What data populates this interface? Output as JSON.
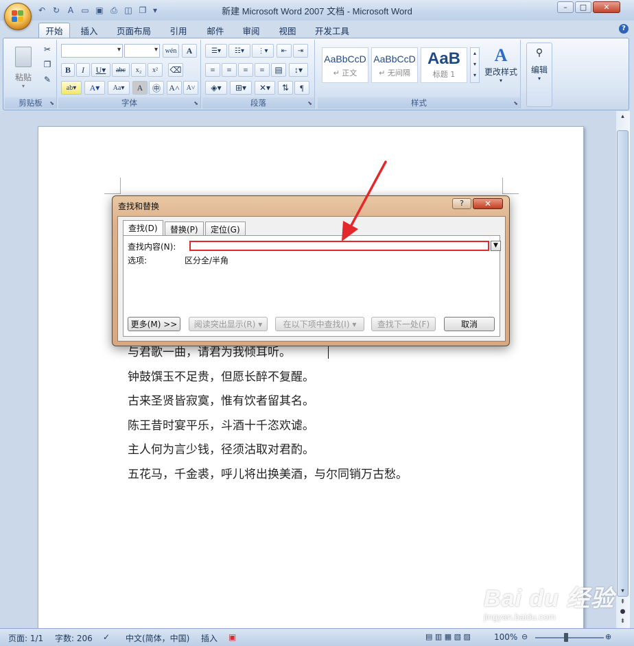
{
  "window": {
    "title": "新建 Microsoft Word 2007 文档 - Microsoft Word"
  },
  "ribbon_tabs": [
    "开始",
    "插入",
    "页面布局",
    "引用",
    "邮件",
    "审阅",
    "视图",
    "开发工具"
  ],
  "ribbon": {
    "clipboard": {
      "label": "剪贴板",
      "paste": "粘贴"
    },
    "font": {
      "label": "字体"
    },
    "paragraph": {
      "label": "段落"
    },
    "styles": {
      "label": "样式",
      "items": [
        {
          "preview": "AaBbCcD",
          "name": "↵ 正文"
        },
        {
          "preview": "AaBbCcD",
          "name": "↵ 无间隔"
        },
        {
          "preview": "AaB",
          "name": "标题 1"
        }
      ],
      "change": "更改样式"
    },
    "editing": {
      "label": "编辑"
    }
  },
  "document": {
    "lines": [
      "与君歌一曲，请君为我倾耳听。",
      "钟鼓馔玉不足贵，但愿长醉不复醒。",
      "古来圣贤皆寂寞，惟有饮者留其名。",
      "陈王昔时宴平乐，斗酒十千恣欢谑。",
      "主人何为言少钱，径须沽取对君酌。",
      "五花马，千金裘，呼儿将出换美酒，与尔同销万古愁。"
    ]
  },
  "dialog": {
    "title": "查找和替换",
    "help": "?",
    "close": "✕",
    "tabs": [
      "查找(D)",
      "替换(P)",
      "定位(G)"
    ],
    "find_label": "查找内容(N):",
    "find_value": "",
    "options_label": "选项:",
    "options_value": "区分全/半角",
    "buttons": {
      "more": "更多(M) >>",
      "reading_highlight": "阅读突出显示(R) ▾",
      "find_in": "在以下项中查找(I) ▾",
      "find_next": "查找下一处(F)",
      "cancel": "取消"
    }
  },
  "statusbar": {
    "page": "页面: 1/1",
    "words": "字数: 206",
    "language": "中文(简体，中国)",
    "mode": "插入",
    "zoom": "100%"
  },
  "watermark": {
    "brand": "Bai du 经验",
    "url": "jingyan.baidu.com"
  },
  "colors": {
    "accent": "#e3272a",
    "ribbon": "#dbe6f4"
  }
}
